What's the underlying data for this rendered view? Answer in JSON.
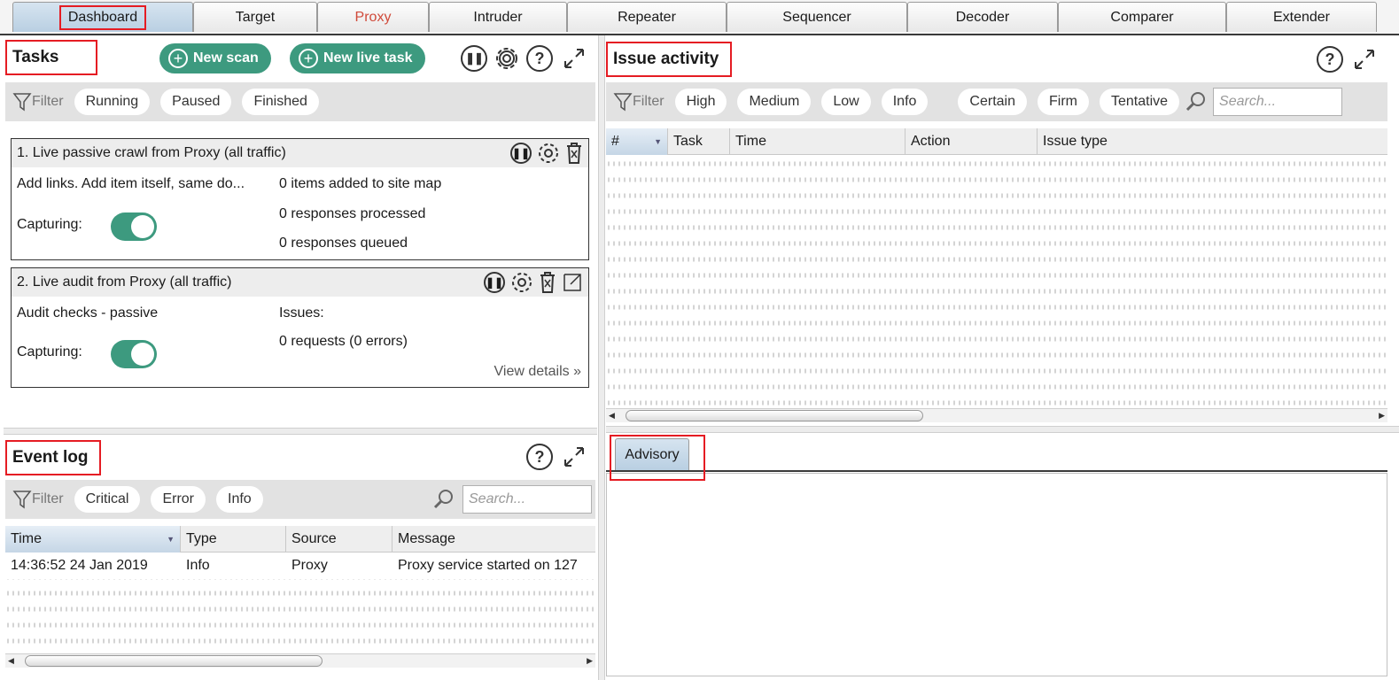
{
  "tabs": [
    {
      "label": "Dashboard"
    },
    {
      "label": "Target"
    },
    {
      "label": "Proxy"
    },
    {
      "label": "Intruder"
    },
    {
      "label": "Repeater"
    },
    {
      "label": "Sequencer"
    },
    {
      "label": "Decoder"
    },
    {
      "label": "Comparer"
    },
    {
      "label": "Extender"
    }
  ],
  "tasks": {
    "title": "Tasks",
    "new_scan_label": "New scan",
    "new_live_task_label": "New live task",
    "filter_label": "Filter",
    "filters": [
      "Running",
      "Paused",
      "Finished"
    ],
    "items": [
      {
        "name": "1. Live passive crawl from Proxy (all traffic)",
        "desc": "Add links. Add item itself, same do...",
        "capturing_label": "Capturing:",
        "stats": [
          "0 items added to site map",
          "0 responses processed",
          "0 responses queued"
        ]
      },
      {
        "name": "2. Live audit from Proxy (all traffic)",
        "desc": "Audit checks - passive",
        "capturing_label": "Capturing:",
        "stats": [
          "Issues:",
          "0 requests (0 errors)"
        ],
        "view_details": "View details"
      }
    ]
  },
  "issue_activity": {
    "title": "Issue activity",
    "filter_label": "Filter",
    "severity_filters": [
      "High",
      "Medium",
      "Low",
      "Info"
    ],
    "confidence_filters": [
      "Certain",
      "Firm",
      "Tentative"
    ],
    "search_placeholder": "Search...",
    "columns": [
      "#",
      "Task",
      "Time",
      "Action",
      "Issue type"
    ]
  },
  "advisory": {
    "tab_label": "Advisory"
  },
  "event_log": {
    "title": "Event log",
    "filter_label": "Filter",
    "filters": [
      "Critical",
      "Error",
      "Info"
    ],
    "search_placeholder": "Search...",
    "columns": [
      "Time",
      "Type",
      "Source",
      "Message"
    ],
    "rows": [
      {
        "time": "14:36:52 24 Jan 2019",
        "type": "Info",
        "source": "Proxy",
        "message": "Proxy service started on 127"
      }
    ]
  },
  "icons": {
    "pause": "pause-circle-icon",
    "settings": "gear-icon",
    "help": "question-circle-icon",
    "expand": "expand-arrows-icon",
    "delete": "trash-icon",
    "open": "open-external-icon",
    "filter": "funnel-icon",
    "search": "magnifier-icon"
  },
  "colors": {
    "accent_green": "#3d9a7f",
    "highlight_red": "#e51c23",
    "proxy_tab": "#d04a3a"
  }
}
